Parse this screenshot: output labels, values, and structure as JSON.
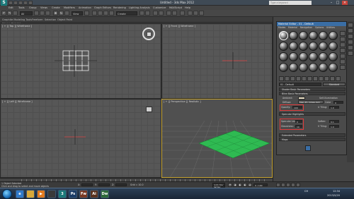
{
  "window": {
    "title": "Untitled - 3ds Max 2012",
    "search_placeholder": "Type a keyword",
    "app_logo": "S"
  },
  "menubar": {
    "items": [
      "Edit",
      "Tools",
      "Group",
      "Views",
      "Create",
      "Modifiers",
      "Animation",
      "Graph Editors",
      "Rendering",
      "Lighting Analysis",
      "Customize",
      "MAXScript",
      "Help"
    ]
  },
  "toolbar": {
    "selection_filter": "All",
    "view_dropdown": "View",
    "named_selection": "Create Selection Se"
  },
  "ribbon": {
    "tabs": [
      "Graphite Modeling Tools",
      "Freeform",
      "Selection",
      "Object Paint"
    ],
    "sub_label": "Polygon Modeling"
  },
  "viewports": {
    "top_label": "[ + ][ Top ][ Wireframe ]",
    "front_label": "[ + ][ Front ][ Wireframe ]",
    "left_label": "[ + ][ Left ][ Wireframe ]",
    "persp_label": "[ + ][ Perspective ][ Realistic ]"
  },
  "material_editor": {
    "title": "Material Editor - 01 - Default",
    "menu": [
      "Modes",
      "Material",
      "Navigation",
      "Options",
      "Utilities"
    ],
    "material_name": "01 - Default",
    "material_type": "Standard",
    "sections": {
      "shader": "Shader Basic Parameters",
      "blinn": "Blinn Basic Parameters",
      "maps": "Maps",
      "extended": "Extended Parameters"
    },
    "params": {
      "ambient": "Ambient:",
      "diffuse": "Diffuse:",
      "map_name": "Map #1 (grass.jpg)",
      "self_illum": "Self-Illumination",
      "color": "Color",
      "color_value": "0",
      "opacity": "Opacity:",
      "opacity_value": "100",
      "specular_highlights": "Specular Highlights",
      "specular_level": "Specular Level:",
      "specular_value": "0",
      "glossiness": "Glossiness:",
      "glossiness_value": "10",
      "soften": "Soften:",
      "soften_value": "0.1",
      "u_tiling": "U Tiling:",
      "u_value": "1.0",
      "v_tiling": "V Tiling:",
      "v_value": "1.0"
    }
  },
  "status": {
    "selection": "1 Object Selected",
    "prompt": "Click and drag to select and move objects",
    "x_label": "X:",
    "y_label": "Y:",
    "z_label": "Z:",
    "grid": "Grid = 10.0",
    "auto_key": "Auto Key",
    "set_key": "Set Key",
    "frame": "0 / 100"
  },
  "taskbar": {
    "time": "12:34",
    "date": "2013/5/20",
    "lang": "CH"
  },
  "colors": {
    "plane_green": "#2fba52",
    "selection_red": "#e23b3b",
    "active_viewport": "#c9a634"
  }
}
